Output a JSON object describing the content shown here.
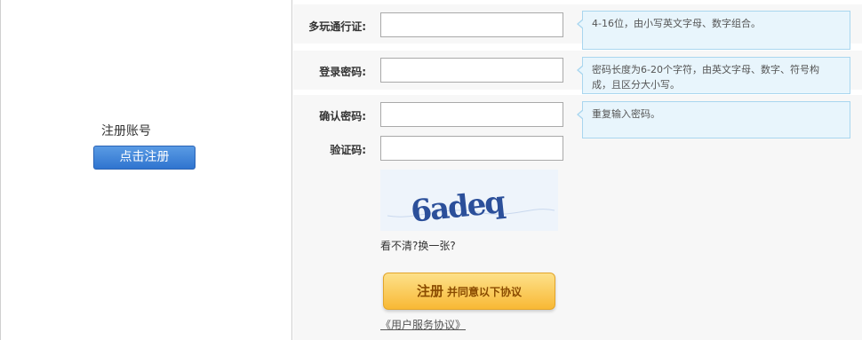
{
  "left_panel": {
    "register_label": "注册账号",
    "register_button": "点击注册"
  },
  "form": {
    "username": {
      "label": "多玩通行证:",
      "value": "",
      "tip": "4-16位，由小写英文字母、数字组合。"
    },
    "password": {
      "label": "登录密码:",
      "value": "",
      "tip_line1": "密码长度为6-20个字符，由英文字母、数字、符号构",
      "tip_line2": "成，且区分大小写。"
    },
    "confirm": {
      "label": "确认密码:",
      "value": "",
      "tip": "重复输入密码。"
    },
    "captcha": {
      "label": "验证码:",
      "value": "",
      "image_text": "6adeq",
      "refresh": "看不清?换一张?"
    },
    "submit": {
      "main": "注册",
      "sub": "并同意以下协议"
    },
    "agreement_link": "《用户服务协议》"
  },
  "colors": {
    "tip_background": "#e8f5fc",
    "tip_border": "#a9d6ef",
    "register_button": "#3d82d6",
    "submit_button": "#f8c44a",
    "captcha_text": "#2b4f9a"
  }
}
